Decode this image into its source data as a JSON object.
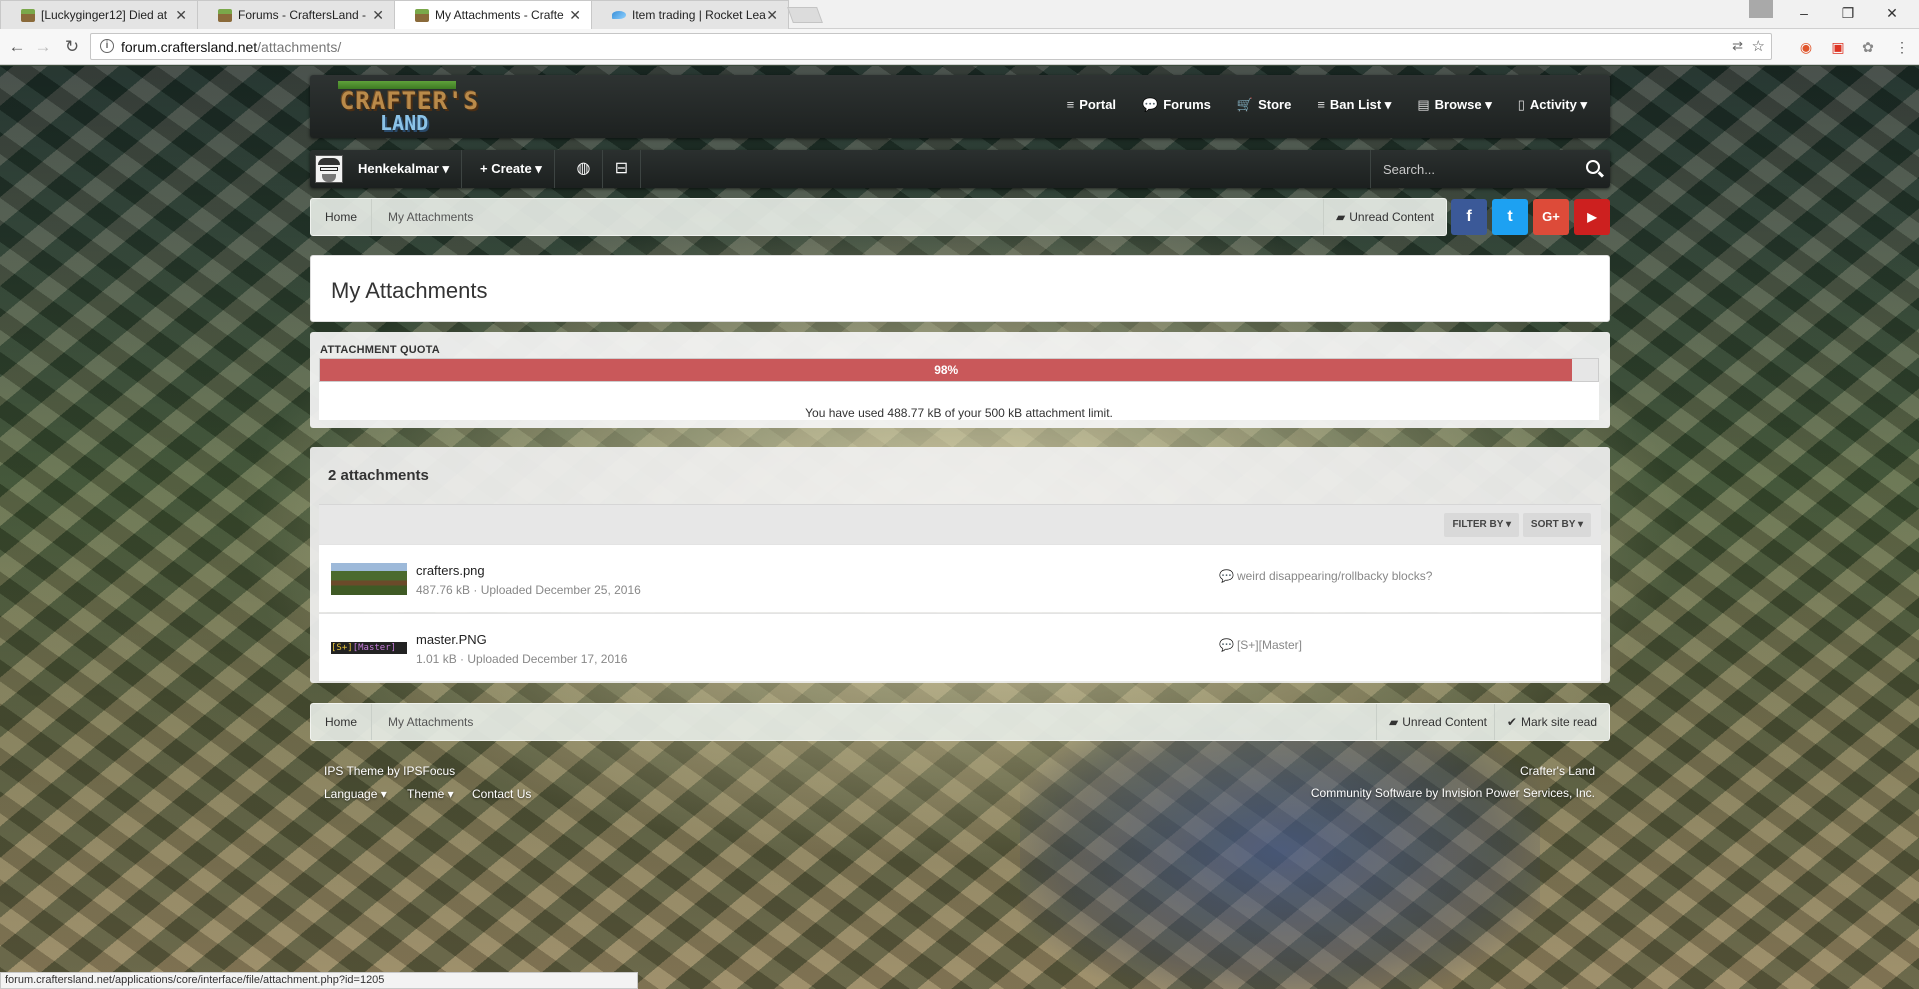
{
  "browser": {
    "tabs": [
      {
        "label": "[Luckyginger12] Died at"
      },
      {
        "label": "Forums - CraftersLand - "
      },
      {
        "label": "My Attachments - Crafte"
      },
      {
        "label": "Item trading | Rocket Lea"
      }
    ],
    "url_host": "forum.craftersland.net",
    "url_path": "/attachments/",
    "status_url": "forum.craftersland.net/applications/core/interface/file/attachment.php?id=1205"
  },
  "site": {
    "logo_top": "CRAFTER'S",
    "logo_bottom": "LAND",
    "nav": [
      {
        "label": "Portal",
        "icon": "≡"
      },
      {
        "label": "Forums",
        "icon": "💬"
      },
      {
        "label": "Store",
        "icon": "🛒"
      },
      {
        "label": "Ban List ▾",
        "icon": "≡"
      },
      {
        "label": "Browse ▾",
        "icon": "▤"
      },
      {
        "label": "Activity ▾",
        "icon": "▯"
      }
    ]
  },
  "userbar": {
    "username": "Henkekalmar ▾",
    "create": "+ Create ▾",
    "search_placeholder": "Search..."
  },
  "breadcrumb": {
    "home": "Home",
    "current": "My Attachments",
    "unread": "Unread Content",
    "mark_read": "Mark site read"
  },
  "social": {
    "facebook": "f",
    "twitter": "t",
    "google": "G+",
    "youtube": "▶"
  },
  "page_title": "My Attachments",
  "quota": {
    "label": "ATTACHMENT QUOTA",
    "percent_label": "98%",
    "percent": 98,
    "text": "You have used 488.77 kB of your 500 kB attachment limit."
  },
  "attachments": {
    "heading": "2 attachments",
    "filter": "FILTER BY ▾",
    "sort": "SORT BY ▾",
    "items": [
      {
        "name": "crafters.png",
        "meta": "487.76 kB · Uploaded December 25, 2016",
        "topic": "weird disappearing/rollbacky blocks?"
      },
      {
        "name": "master.PNG",
        "meta": "1.01 kB · Uploaded December 17, 2016",
        "topic": "[S+][Master]",
        "thumb_text": "[S+][Master]"
      }
    ]
  },
  "footer": {
    "theme_credit": "IPS Theme by IPSFocus",
    "language": "Language ▾",
    "theme": "Theme ▾",
    "contact": "Contact Us",
    "site_name": "Crafter's Land",
    "software": "Community Software by Invision Power Services, Inc."
  },
  "colors": {
    "quota_bar": "#c9585a",
    "facebook": "#3b5998",
    "twitter": "#1da1f2",
    "google": "#dd4b39",
    "youtube": "#cd201f"
  }
}
